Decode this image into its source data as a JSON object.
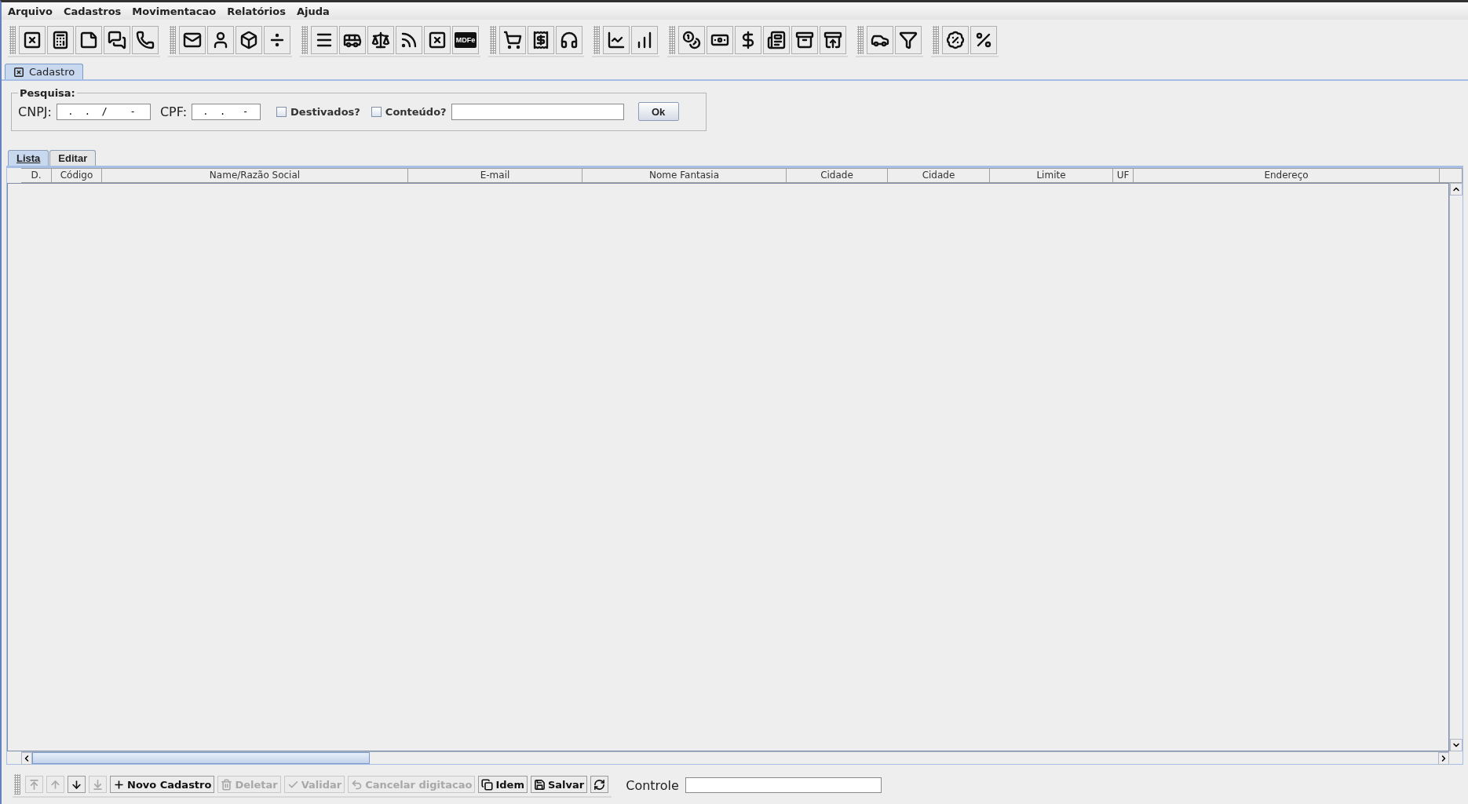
{
  "menu": [
    {
      "label": "Arquivo"
    },
    {
      "label": "Cadastros"
    },
    {
      "label": "Movimentacao"
    },
    {
      "label": "Relatórios"
    },
    {
      "label": "Ajuda"
    }
  ],
  "toolbar": {
    "mdfe_label": "MDFe"
  },
  "document_tab": {
    "title": "Cadastro"
  },
  "search": {
    "title": "Pesquisa:",
    "cnpj_label": "CNPJ:",
    "cnpj_value": " .  .  /    -",
    "cpf_label": "CPF:",
    "cpf_value": " .  .   -",
    "checkboxes": [
      {
        "label": "Destivados?",
        "checked": false
      },
      {
        "label": "Conteúdo?",
        "checked": false
      }
    ],
    "ok_button": "Ok"
  },
  "tabs": [
    {
      "label": "Lista",
      "selected": true
    },
    {
      "label": "Editar",
      "selected": false
    }
  ],
  "table": {
    "columns": [
      "D.",
      "Código",
      "Name/Razão Social",
      "E-mail",
      "Nome Fantasia",
      "Cidade",
      "Cidade",
      "Limite",
      "UF",
      "Endereço"
    ]
  },
  "bottom_bar": {
    "buttons": [
      {
        "kind": "first",
        "disabled": true
      },
      {
        "kind": "up",
        "disabled": true
      },
      {
        "kind": "down",
        "disabled": false
      },
      {
        "kind": "last",
        "disabled": true
      },
      {
        "kind": "new",
        "label": "Novo Cadastro",
        "disabled": false
      },
      {
        "kind": "delete",
        "label": "Deletar",
        "disabled": true
      },
      {
        "kind": "validate",
        "label": "Validar",
        "disabled": true
      },
      {
        "kind": "cancel",
        "label": "Cancelar digitacao",
        "disabled": true
      },
      {
        "kind": "copy",
        "label": "Idem",
        "disabled": false
      },
      {
        "kind": "save",
        "label": "Salvar",
        "disabled": false
      },
      {
        "kind": "refresh",
        "disabled": false
      }
    ],
    "control_label": "Controle"
  }
}
